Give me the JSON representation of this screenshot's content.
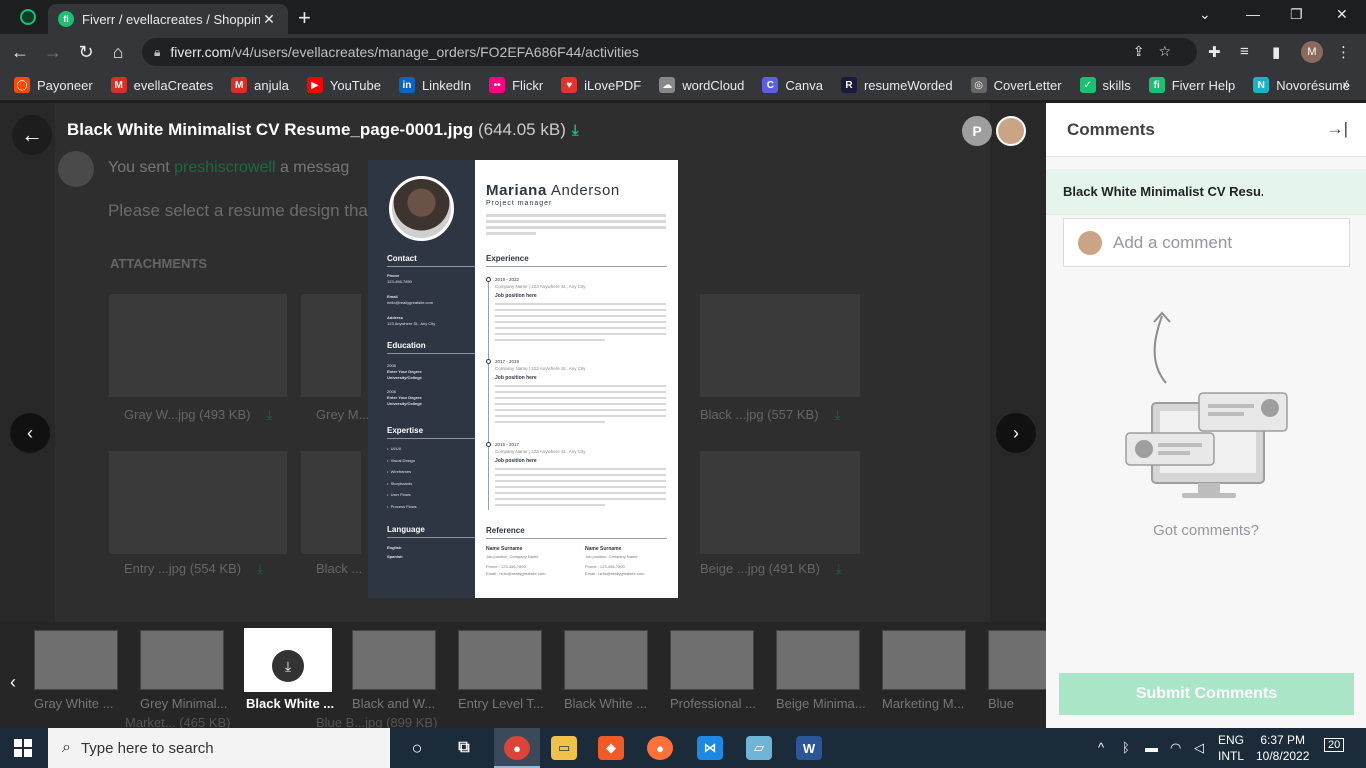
{
  "browser": {
    "tab_title": "Fiverr / evellacreates / Shopping",
    "tab_favicon": "fi",
    "url_domain": "fiverr.com",
    "url_path": "/v4/users/evellacreates/manage_orders/FO2EFA686F44/activities",
    "profile_initial": "M",
    "bookmarks": [
      {
        "label": "Payoneer",
        "icon": "payoneer-icon",
        "color": "#ff4800",
        "glyph": "◯"
      },
      {
        "label": "evellaCreates",
        "icon": "gmail-icon",
        "color": "#d93025",
        "glyph": "M"
      },
      {
        "label": "anjula",
        "icon": "gmail-icon",
        "color": "#d93025",
        "glyph": "M"
      },
      {
        "label": "YouTube",
        "icon": "youtube-icon",
        "color": "#ff0000",
        "glyph": "▶"
      },
      {
        "label": "LinkedIn",
        "icon": "linkedin-icon",
        "color": "#0a66c2",
        "glyph": "in"
      },
      {
        "label": "Flickr",
        "icon": "flickr-icon",
        "color": "#ff0084",
        "glyph": "••"
      },
      {
        "label": "iLovePDF",
        "icon": "ilovepdf-icon",
        "color": "#e5322d",
        "glyph": "♥"
      },
      {
        "label": "wordCloud",
        "icon": "cloud-icon",
        "color": "#888888",
        "glyph": "☁"
      },
      {
        "label": "Canva",
        "icon": "canva-icon",
        "color": "#5b5ee0",
        "glyph": "C"
      },
      {
        "label": "resumeWorded",
        "icon": "resumeworded-icon",
        "color": "#1a1a3a",
        "glyph": "R"
      },
      {
        "label": "CoverLetter",
        "icon": "globe-icon",
        "color": "#666666",
        "glyph": "◎"
      },
      {
        "label": "skills",
        "icon": "skills-icon",
        "color": "#1dbf73",
        "glyph": "✓"
      },
      {
        "label": "Fiverr Help",
        "icon": "fiverr-icon",
        "color": "#1dbf73",
        "glyph": "fi"
      },
      {
        "label": "Novorésumé",
        "icon": "novoresume-icon",
        "color": "#19b5c7",
        "glyph": "N"
      }
    ]
  },
  "viewer": {
    "file_name": "Black White Minimalist CV Resume_page-0001.jpg",
    "file_size": "(644.05 kB)",
    "participant_initial": "P",
    "bg_message_prefix": "You sent ",
    "bg_message_user": "preshiscrowell",
    "bg_message_suffix": " a messag",
    "bg_select": "Please select a resume design tha",
    "bg_attachments": "ATTACHMENTS",
    "bg_cards": [
      {
        "label": "Gray W...jpg",
        "size": "(493 KB)"
      },
      {
        "label": "Grey M...",
        "size": ""
      },
      {
        "label": "Black ...jpg",
        "size": "(557 KB)"
      },
      {
        "label": "Entry ...jpg",
        "size": "(554 KB)"
      },
      {
        "label": "Black ...",
        "size": ""
      },
      {
        "label": "Beige ...jpg",
        "size": "(491 KB)"
      }
    ],
    "bg_bottom": [
      {
        "label": "Market...",
        "size": "(465 KB)"
      },
      {
        "label": "Blue B...jpg",
        "size": "(899 KB)"
      }
    ]
  },
  "resume": {
    "first_name": "Mariana",
    "last_name": "Anderson",
    "role": "Project manager",
    "sections": {
      "contact": "Contact",
      "education": "Education",
      "expertise": "Expertise",
      "language": "Language",
      "experience": "Experience",
      "reference": "Reference"
    },
    "contact": {
      "phone_label": "Phone",
      "phone": "123-456-7890",
      "email_label": "Email",
      "email": "hello@reallygreatsite.com",
      "address_label": "Address",
      "address": "123 Anywhere St., Any City"
    },
    "education": [
      {
        "year": "2008",
        "degree": "Enter Your Degree",
        "school": "University/College"
      },
      {
        "year": "2008",
        "degree": "Enter Your Degree",
        "school": "University/College"
      }
    ],
    "expertise": [
      "UI/UX",
      "Visual Design",
      "Wireframes",
      "Storyboards",
      "User Flows",
      "Process Flows"
    ],
    "languages": [
      "English",
      "Spanish"
    ],
    "experience": [
      {
        "dates": "2019 - 2022",
        "company": "Company Name | 123 Anywhere St., Any City",
        "position": "Job position here"
      },
      {
        "dates": "2017 - 2019",
        "company": "Company Name | 123 Anywhere St., Any City",
        "position": "Job position here"
      },
      {
        "dates": "2015 - 2017",
        "company": "Company Name | 123 Anywhere St., Any City",
        "position": "Job position here"
      }
    ],
    "references": [
      {
        "name": "Name Surname",
        "position": "Job position, Company Name",
        "phone": "Phone : 123-456-7890",
        "email": "Email : hello@reallygreatsite.com"
      },
      {
        "name": "Name Surname",
        "position": "Job position, Company Name",
        "phone": "Phone : 123-456-7890",
        "email": "Email : hello@reallygreatsite.com"
      }
    ]
  },
  "thumbnails": [
    {
      "label": "Gray White ...",
      "selected": false
    },
    {
      "label": "Grey Minimal...",
      "selected": false
    },
    {
      "label": "Black White ...",
      "selected": true
    },
    {
      "label": "Black and W...",
      "selected": false
    },
    {
      "label": "Entry Level T...",
      "selected": false
    },
    {
      "label": "Black White ...",
      "selected": false
    },
    {
      "label": "Professional ...",
      "selected": false
    },
    {
      "label": "Beige Minima...",
      "selected": false
    },
    {
      "label": "Marketing M...",
      "selected": false
    },
    {
      "label": "Blue",
      "selected": false
    }
  ],
  "comments": {
    "title": "Comments",
    "file_label": "Black White Minimalist CV Resu...",
    "add_placeholder": "Add a comment",
    "empty_text": "Got comments?",
    "submit_label": "Submit Comments"
  },
  "taskbar": {
    "search_placeholder": "Type here to search",
    "lang_top": "ENG",
    "lang_bottom": "INTL",
    "time": "6:37 PM",
    "date": "10/8/2022",
    "notifications": "20"
  }
}
